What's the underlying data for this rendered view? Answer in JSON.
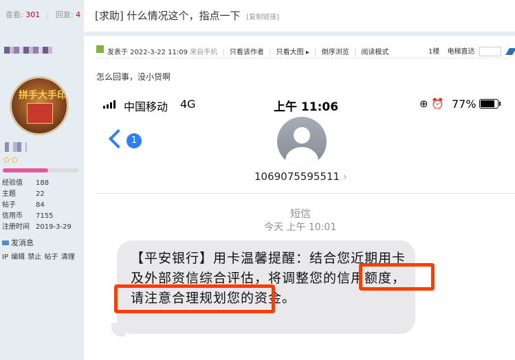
{
  "thread": {
    "views_label": "查看:",
    "views": "301",
    "replies_label": "回复:",
    "replies": "4",
    "title": "[求助] 什么情况这个，指点一下",
    "copy_link": "[复制链接]"
  },
  "user": {
    "stats": [
      {
        "k": "经验值",
        "v": "188"
      },
      {
        "k": "主题",
        "v": "22"
      },
      {
        "k": "帖子",
        "v": "84"
      },
      {
        "k": "信用币",
        "v": "7155"
      },
      {
        "k": "注册时间",
        "v": "2019-3-29"
      }
    ],
    "stars": "✩✩",
    "send_message": "发消息",
    "admin_links": "IP 编辑 禁止 帖子 清理",
    "avatar_text": "拼手大手印",
    "progress": 0.6,
    "avatar_border_color": "#d9c7a0",
    "progress_color": "#e7559a"
  },
  "post": {
    "published": "发表于 2022-3-22 11:09",
    "source": "来自手机",
    "only_author": "只看该作者",
    "only_images": "只看大图",
    "reverse": "倒序浏览",
    "reading_mode": "阅读模式",
    "floor": "1楼",
    "elevator": "电梯直达",
    "content": "怎么回事，没小贷啊",
    "icon_color": "#7fb53c"
  },
  "phone": {
    "carrier": "中国移动",
    "network": "4G",
    "time": "上午 11:06",
    "status_icons": "⊕ ⏰",
    "battery_pct": "77%",
    "battery_level": 0.77,
    "back_badge": "1",
    "contact_number": "1069075595511",
    "chevron": "›",
    "sms_label": "短信",
    "sms_time": "今天 上午 10:01",
    "message": "【平安银行】用卡温馨提醒：结合您近期用卡及外部资信综合评估，将调整您的信用额度，请注意合理规划您的资金。",
    "accent_color": "#2f7ef6",
    "highlight_color": "#ff3d00"
  }
}
